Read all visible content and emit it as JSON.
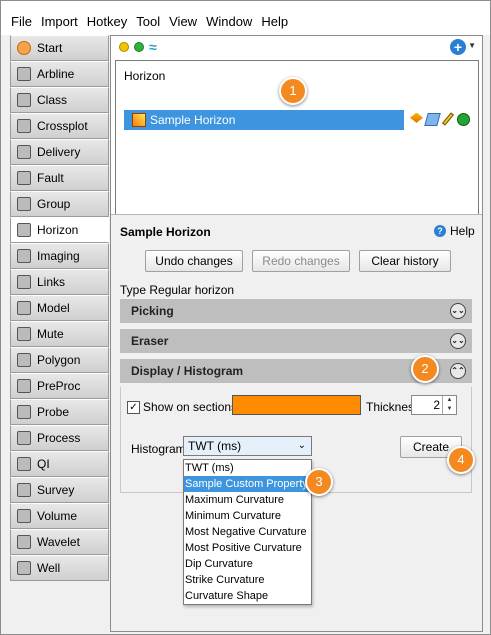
{
  "menu": [
    "File",
    "Import",
    "Hotkey",
    "Tool",
    "View",
    "Window",
    "Help"
  ],
  "nav": [
    {
      "label": "Start",
      "icon": "start-icon"
    },
    {
      "label": "Arbline",
      "icon": "arbline-icon"
    },
    {
      "label": "Class",
      "icon": "class-icon"
    },
    {
      "label": "Crossplot",
      "icon": "crossplot-icon"
    },
    {
      "label": "Delivery",
      "icon": "delivery-icon"
    },
    {
      "label": "Fault",
      "icon": "fault-icon"
    },
    {
      "label": "Group",
      "icon": "group-icon"
    },
    {
      "label": "Horizon",
      "icon": "horizon-icon",
      "active": true
    },
    {
      "label": "Imaging",
      "icon": "imaging-icon"
    },
    {
      "label": "Links",
      "icon": "links-icon"
    },
    {
      "label": "Model",
      "icon": "model-icon"
    },
    {
      "label": "Mute",
      "icon": "mute-icon"
    },
    {
      "label": "Polygon",
      "icon": "polygon-icon"
    },
    {
      "label": "PreProc",
      "icon": "preproc-icon"
    },
    {
      "label": "Probe",
      "icon": "probe-icon"
    },
    {
      "label": "Process",
      "icon": "process-icon"
    },
    {
      "label": "QI",
      "icon": "qi-icon"
    },
    {
      "label": "Survey",
      "icon": "survey-icon"
    },
    {
      "label": "Volume",
      "icon": "volume-icon"
    },
    {
      "label": "Wavelet",
      "icon": "wavelet-icon"
    },
    {
      "label": "Well",
      "icon": "well-icon"
    }
  ],
  "list": {
    "title": "Horizon",
    "row_label": "Sample Horizon"
  },
  "detail": {
    "title": "Sample Horizon",
    "help_label": "Help",
    "undo_label": "Undo changes",
    "redo_label": "Redo changes",
    "clear_label": "Clear history",
    "type_line": "Type Regular horizon",
    "sections": {
      "picking": "Picking",
      "eraser": "Eraser",
      "display": "Display / Histogram"
    },
    "show_on_sections_label": "Show on sections",
    "thickness_label": "Thickness",
    "thickness_value": "2",
    "histogram_label": "Histogram",
    "histogram_selected": "TWT (ms)",
    "create_label": "Create",
    "options": [
      "TWT (ms)",
      "Sample Custom Property",
      "Maximum Curvature",
      "Minimum Curvature",
      "Most Negative Curvature",
      "Most Positive Curvature",
      "Dip Curvature",
      "Strike Curvature",
      "Curvature Shape"
    ]
  },
  "callouts": [
    "1",
    "2",
    "3",
    "4"
  ],
  "colors": {
    "selection": "#3d95e0",
    "horizon_color": "#ff8c00",
    "callout": "#f4891f"
  }
}
